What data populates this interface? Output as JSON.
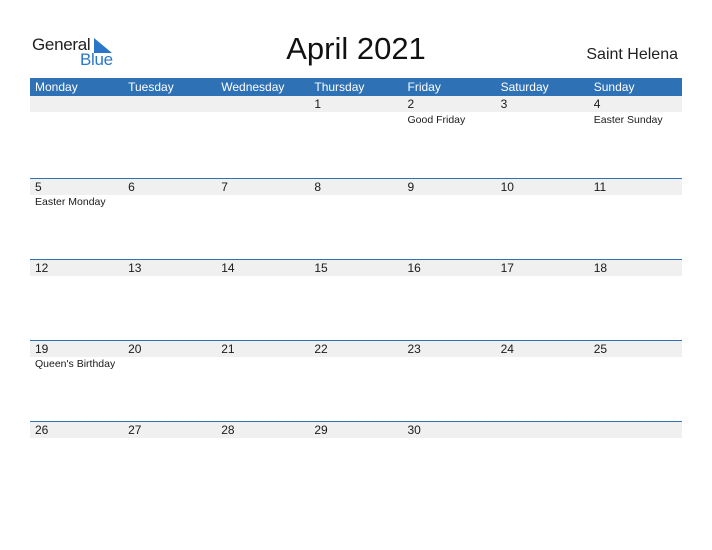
{
  "logo": {
    "word1": "General",
    "word2": "Blue"
  },
  "title": "April 2021",
  "region": "Saint Helena",
  "colors": {
    "accent": "#2e71b5",
    "row_band": "#f0f0f0",
    "logo_blue": "#2a77c9"
  },
  "weekdays": [
    "Monday",
    "Tuesday",
    "Wednesday",
    "Thursday",
    "Friday",
    "Saturday",
    "Sunday"
  ],
  "weeks": [
    {
      "days": [
        "",
        "",
        "",
        "1",
        "2",
        "3",
        "4"
      ],
      "holidays": [
        "",
        "",
        "",
        "",
        "Good Friday",
        "",
        "Easter Sunday"
      ]
    },
    {
      "days": [
        "5",
        "6",
        "7",
        "8",
        "9",
        "10",
        "11"
      ],
      "holidays": [
        "Easter Monday",
        "",
        "",
        "",
        "",
        "",
        ""
      ]
    },
    {
      "days": [
        "12",
        "13",
        "14",
        "15",
        "16",
        "17",
        "18"
      ],
      "holidays": [
        "",
        "",
        "",
        "",
        "",
        "",
        ""
      ]
    },
    {
      "days": [
        "19",
        "20",
        "21",
        "22",
        "23",
        "24",
        "25"
      ],
      "holidays": [
        "Queen's Birthday",
        "",
        "",
        "",
        "",
        "",
        ""
      ]
    },
    {
      "days": [
        "26",
        "27",
        "28",
        "29",
        "30",
        "",
        ""
      ],
      "holidays": [
        "",
        "",
        "",
        "",
        "",
        "",
        ""
      ]
    }
  ]
}
